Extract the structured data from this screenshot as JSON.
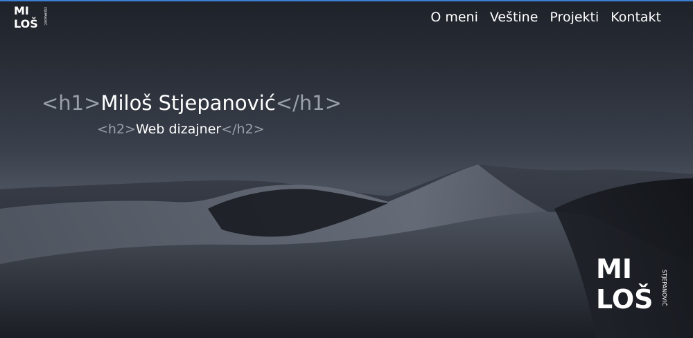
{
  "logo": {
    "line1": "MI",
    "line2": "LOŠ",
    "side_text": "STJEPANOVIĆ"
  },
  "nav": {
    "items": [
      "O meni",
      "Veštine",
      "Projekti",
      "Kontakt"
    ]
  },
  "hero": {
    "h1_open": "<h1>",
    "h1_text": "Miloš Stjepanović",
    "h1_close": "</h1>",
    "h2_open": "<h2>",
    "h2_text": "Web dizajner",
    "h2_close": "</h2>"
  },
  "colors": {
    "accent_border": "#3d7fd6",
    "tag": "#9aa0a8",
    "text": "#ffffff"
  }
}
